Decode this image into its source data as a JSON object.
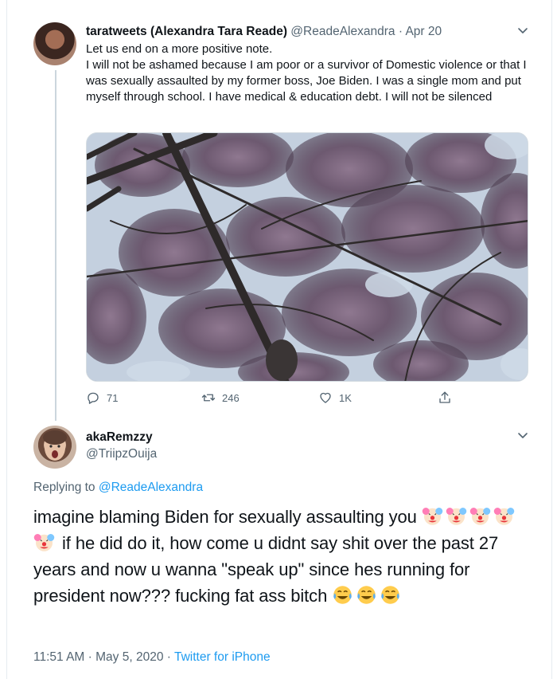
{
  "tweet": {
    "display_name": "taratweets (Alexandra Tara Reade)",
    "handle": "@ReadeAlexandra",
    "separator": "·",
    "date": "Apr 20",
    "lines": [
      "Let us end on a more positive note.",
      "I will not be ashamed because I am poor or a survivor of Domestic violence or that I was sexually assaulted by my former boss, Joe Biden. I was a single mom and put myself through school. I have medical & education debt. I will not be silenced"
    ],
    "actions": {
      "replies": "71",
      "retweets": "246",
      "likes": "1K"
    }
  },
  "reply": {
    "display_name": "akaRemzzy",
    "handle": "@TriipzOuija",
    "replying_prefix": "Replying to",
    "replying_to": "@ReadeAlexandra",
    "text_part1": "imagine blaming Biden for sexually assaulting you",
    "text_part2": " if he did do it, how come u didnt say shit over the past 27 years and now u wanna \"speak up\" since hes running for president now??? fucking fat ass bitch",
    "time": "11:51 AM",
    "separator": "·",
    "date": "May 5, 2020",
    "source": "Twitter for iPhone"
  },
  "icons": {
    "reply": "speech-bubble-icon",
    "retweet": "retweet-arrows-icon",
    "like": "heart-icon",
    "share": "share-upload-icon",
    "menu": "chevron-down-icon",
    "clown": "clown-face-emoji",
    "laugh": "tears-of-joy-emoji"
  },
  "colors": {
    "link": "#1d9bf0",
    "secondary_text": "#536471",
    "primary_text": "#0f1419"
  }
}
